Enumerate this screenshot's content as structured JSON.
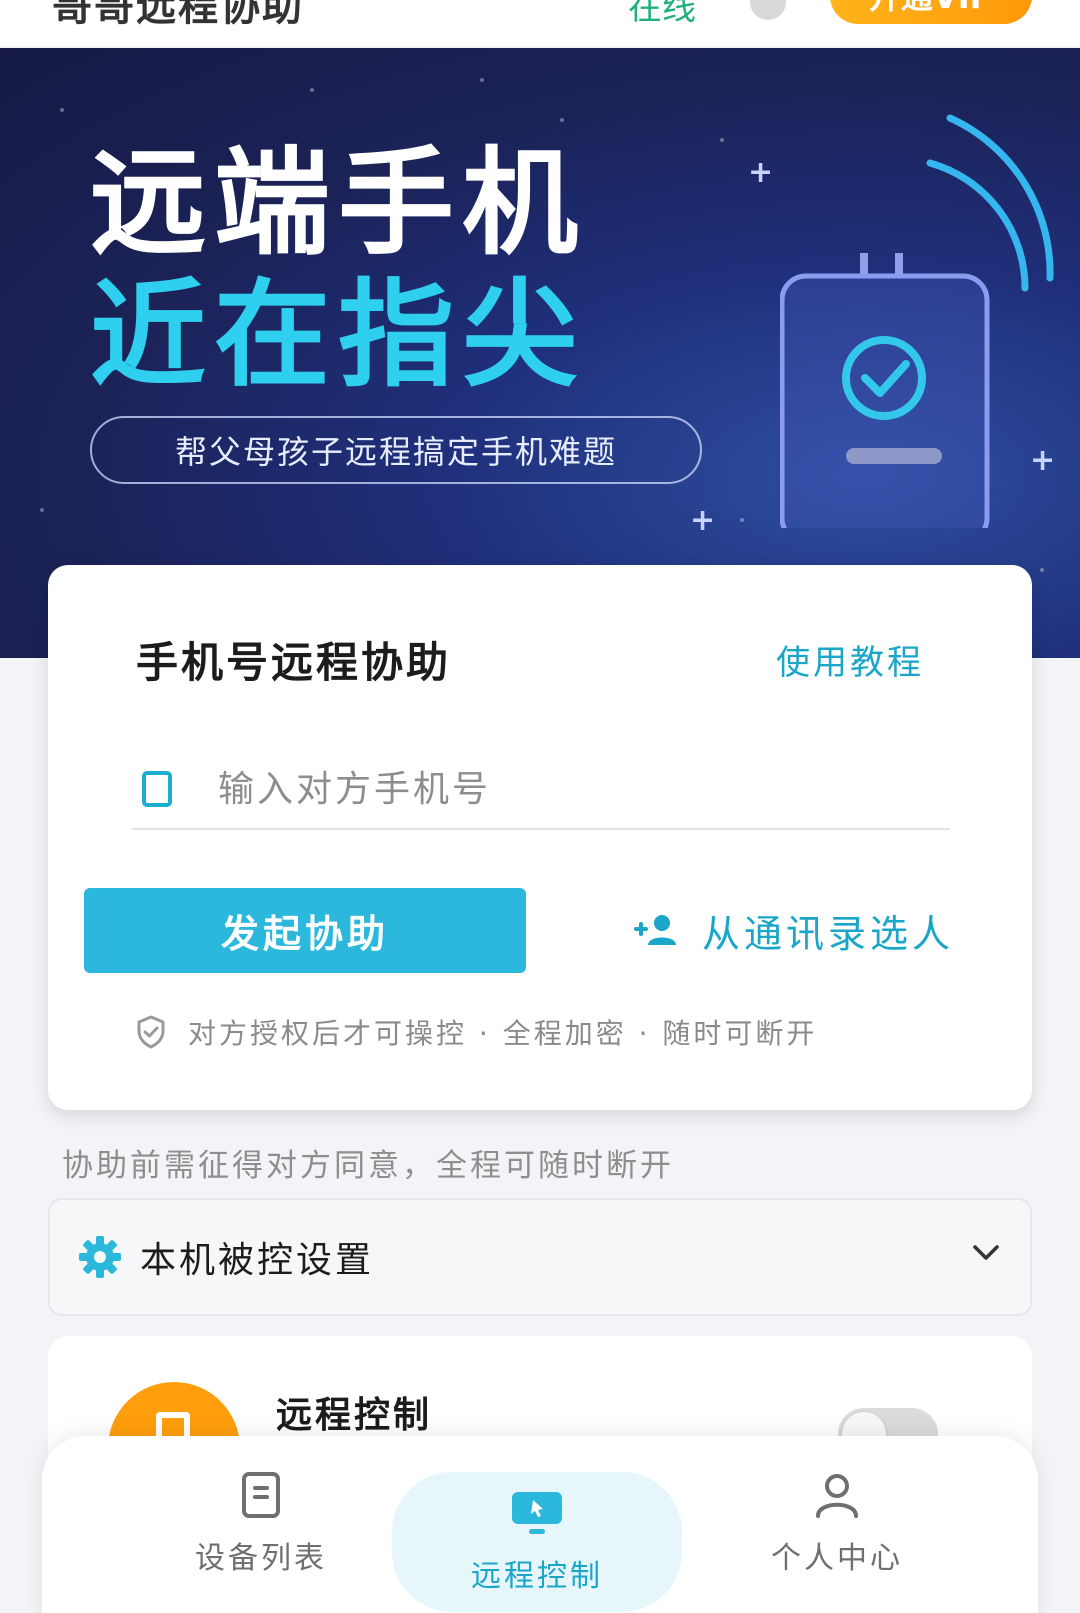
{
  "header": {
    "app_title": "哥哥远程协助",
    "status": "在线",
    "vip_button": "开通VIP"
  },
  "hero": {
    "headline_line1": "远端手机",
    "headline_line2": "近在指尖",
    "tagline": "帮父母孩子远程搞定手机难题"
  },
  "assist_card": {
    "title": "手机号远程协助",
    "tutorial_link": "使用教程",
    "phone_placeholder": "输入对方手机号",
    "phone_value": "",
    "start_button": "发起协助",
    "contacts_link": "从通讯录选人",
    "security_note": "对方授权后才可操控 · 全程加密 · 随时可断开"
  },
  "consent_note": "协助前需征得对方同意，全程可随时断开",
  "settings": {
    "label": "本机被控设置",
    "expanded": false
  },
  "remote_item": {
    "label": "远程控制",
    "toggle_on": false
  },
  "bottom_nav": {
    "items": [
      {
        "label": "设备列表",
        "icon": "device-list-icon",
        "active": false
      },
      {
        "label": "远程控制",
        "icon": "remote-control-icon",
        "active": true
      },
      {
        "label": "个人中心",
        "icon": "profile-icon",
        "active": false
      }
    ]
  },
  "colors": {
    "accent": "#2bb8dc",
    "link": "#1aa6c8",
    "vip": "#ff9a0a",
    "online": "#21b07a",
    "hero_highlight": "#2fd0ef"
  }
}
